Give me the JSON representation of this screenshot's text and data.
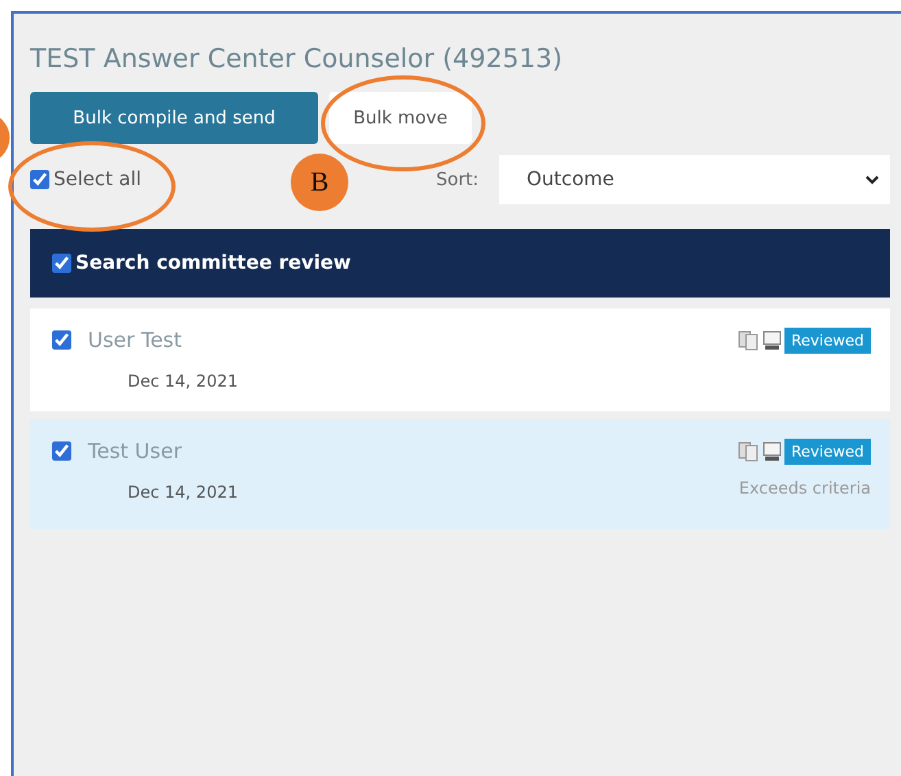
{
  "title": "TEST Answer Center Counselor (492513)",
  "buttons": [
    {
      "label": "Bulk compile and send",
      "kind": "primary"
    },
    {
      "label": "Bulk move",
      "kind": "plain"
    }
  ],
  "select_all": {
    "label": "Select all",
    "checked": true
  },
  "sort": {
    "label": "Sort:",
    "value": "Outcome"
  },
  "group": {
    "title": "Search committee review",
    "checked": true
  },
  "rows": [
    {
      "name": "User Test",
      "date": "Dec 14, 2021",
      "checked": true,
      "highlighted": false,
      "badge": "Reviewed"
    },
    {
      "name": "Test User",
      "date": "Dec 14, 2021",
      "checked": true,
      "highlighted": true,
      "badge": "Reviewed",
      "note": "Exceeds criteria"
    }
  ],
  "callouts": [
    {
      "label": "B"
    }
  ]
}
